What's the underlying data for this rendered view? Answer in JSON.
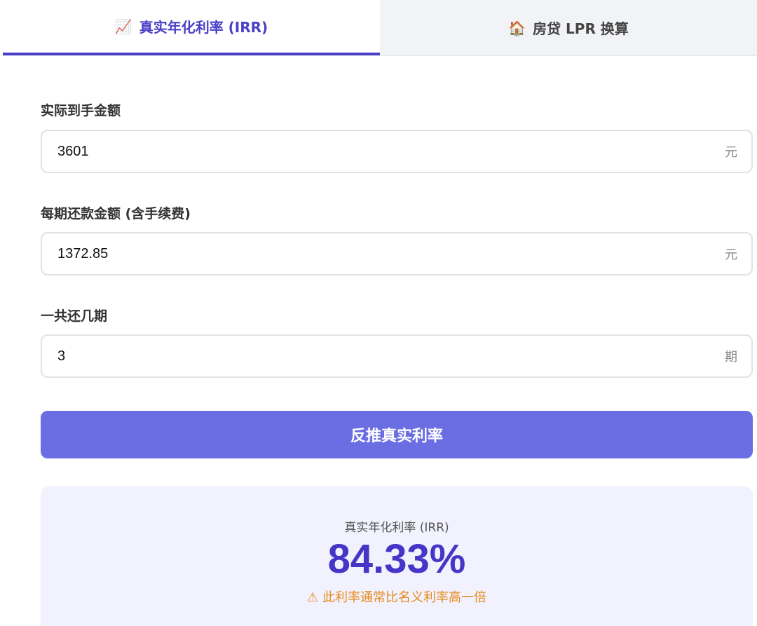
{
  "tabs": [
    {
      "icon": "📈",
      "label": "真实年化利率 (IRR)",
      "active": true
    },
    {
      "icon": "🏠",
      "label": "房贷 LPR 换算",
      "active": false
    }
  ],
  "fields": {
    "received": {
      "label": "实际到手金额",
      "value": "3601",
      "unit": "元"
    },
    "payment": {
      "label": "每期还款金额 (含手续费)",
      "value": "1372.85",
      "unit": "元"
    },
    "periods": {
      "label": "一共还几期",
      "value": "3",
      "unit": "期"
    }
  },
  "button": {
    "label": "反推真实利率"
  },
  "result": {
    "label": "真实年化利率 (IRR)",
    "value": "84.33%",
    "warning_icon": "⚠",
    "warning": "此利率通常比名义利率高一倍"
  },
  "colors": {
    "accent": "#4a3fc8",
    "button": "#6b6ee3",
    "result_bg": "#f1f2fd",
    "warning": "#e88a1c"
  }
}
